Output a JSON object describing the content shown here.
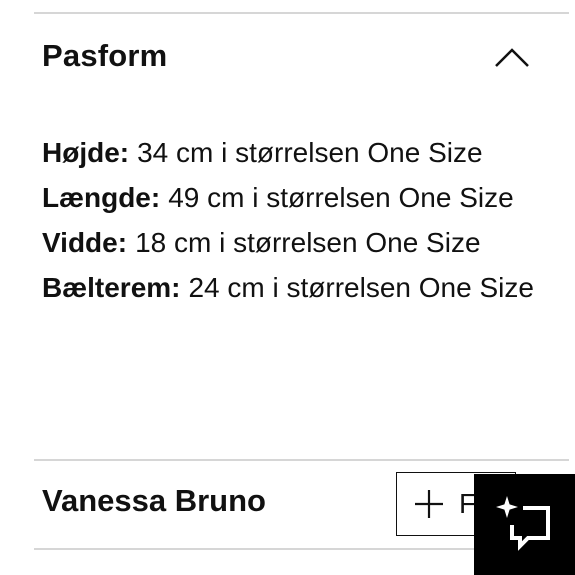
{
  "section": {
    "title": "Pasform",
    "toggle_icon": "chevron-up-icon",
    "specs": [
      {
        "label": "Højde:",
        "value": "34 cm i størrelsen One Size"
      },
      {
        "label": "Længde:",
        "value": "49 cm i størrelsen One Size"
      },
      {
        "label": "Vidde:",
        "value": "18 cm i størrelsen One Size"
      },
      {
        "label": "Bælterem:",
        "value": "24 cm i størrelsen One Size"
      }
    ]
  },
  "brand": {
    "name": "Vanessa Bruno",
    "follow_label": "F",
    "follow_icon": "plus-icon"
  },
  "fab": {
    "icon": "sparkle-chat-icon",
    "background": "#000000"
  }
}
